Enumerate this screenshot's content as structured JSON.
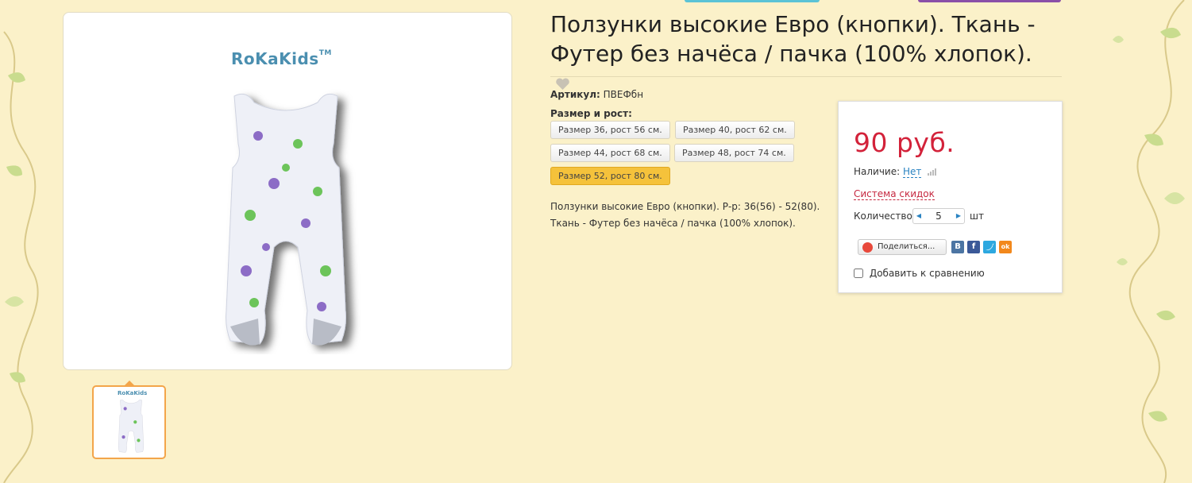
{
  "product": {
    "title": "Ползунки высокие Евро (кнопки). Ткань - Футер без начёса / пачка (100% хлопок).",
    "sku_label": "Артикул:",
    "sku_value": "ПВЕФбн",
    "size_label": "Размер и рост:",
    "sizes": [
      "Размер 36, рост 56 см.",
      "Размер 40, рост 62 см.",
      "Размер 44, рост 68 см.",
      "Размер 48, рост 74 см.",
      "Размер 52, рост 80 см."
    ],
    "selected_size": "Размер 52, рост 80 см.",
    "description_line1": "Ползунки высокие Евро (кнопки). Р-р: 36(56) - 52(80).",
    "description_line2": "Ткань - Футер без начёса / пачка (100% хлопок).",
    "brand": "RoKaKids"
  },
  "buy": {
    "price": "90 руб.",
    "availability_label": "Наличие:",
    "availability_value": "Нет",
    "discount_link": "Система скидок",
    "quantity_label": "Количество:",
    "quantity_value": "5",
    "quantity_unit": "шт",
    "share_label": "Поделиться...",
    "social": {
      "vk": "В",
      "fb": "f",
      "ok": "ok"
    },
    "compare_label": "Добавить к сравнению"
  },
  "colors": {
    "background": "#fbf1c9",
    "price": "#d3223a",
    "accent": "#f5c23b",
    "link": "#2a83c2"
  }
}
